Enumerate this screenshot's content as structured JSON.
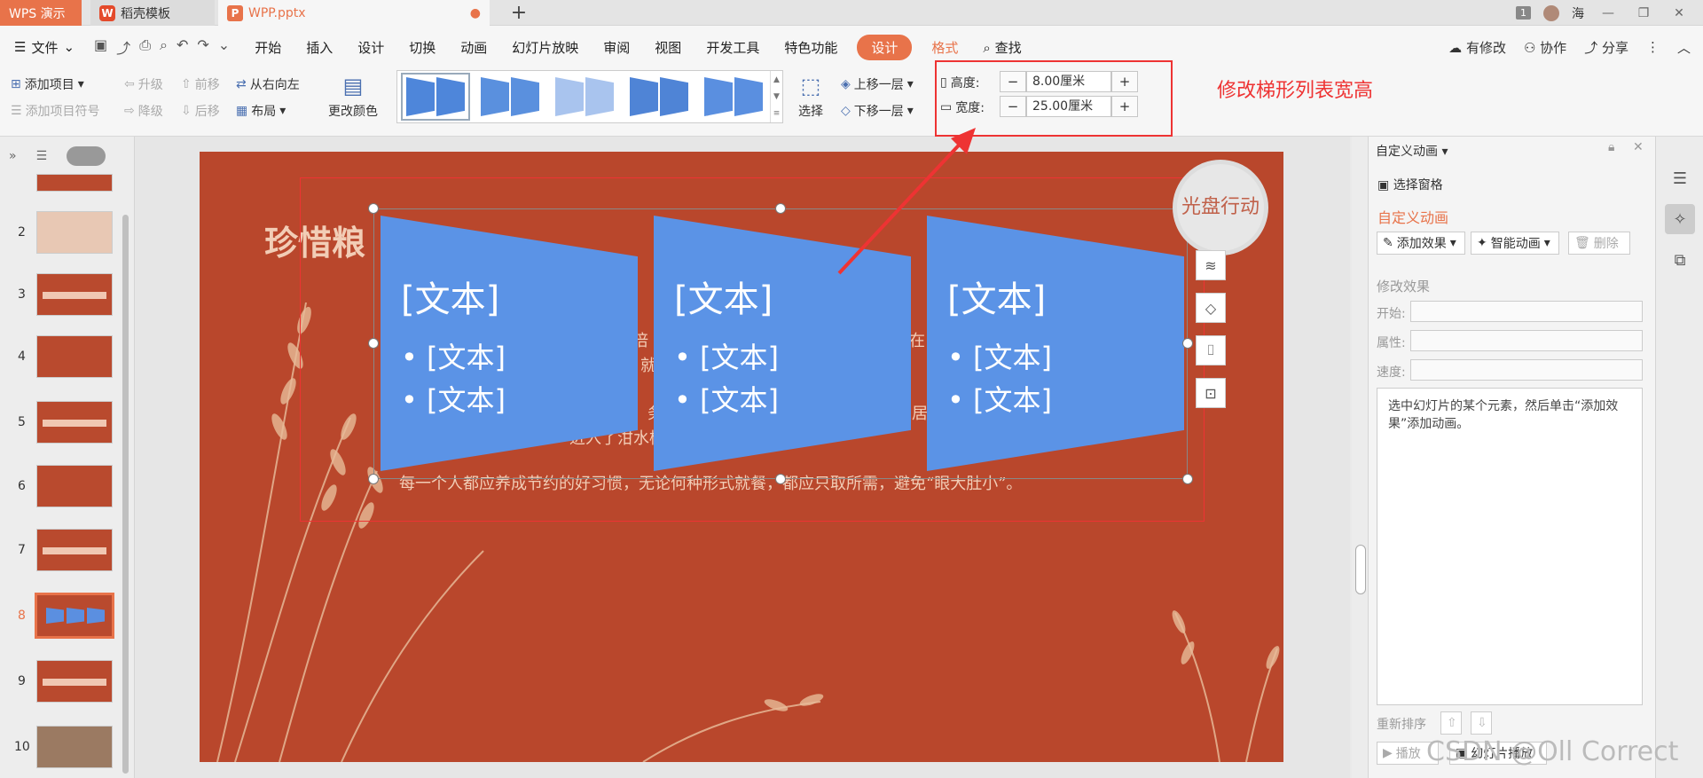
{
  "titlebar": {
    "wps_tab": "WPS 演示",
    "template_tab": "稻壳模板",
    "doc_tab": "WPP.pptx",
    "count_badge": "1",
    "user_name": "海"
  },
  "menu": {
    "file": "文件",
    "items": [
      "开始",
      "插入",
      "设计",
      "切换",
      "动画",
      "幻灯片放映",
      "审阅",
      "视图",
      "开发工具",
      "特色功能"
    ],
    "active": "设计",
    "format": "格式",
    "search": "查找",
    "right": [
      "有修改",
      "协作",
      "分享"
    ]
  },
  "ribbon": {
    "add_item": "添加项目",
    "promote": "升级",
    "forward": "前移",
    "right_to_left": "从右向左",
    "add_bullet": "添加项目符号",
    "demote": "降级",
    "backward": "后移",
    "layout": "布局",
    "change_color": "更改颜色",
    "select": "选择",
    "bring_forward": "上移一层",
    "send_backward": "下移一层",
    "height_label": "高度:",
    "height_value": "8.00厘米",
    "width_label": "宽度:",
    "width_value": "25.00厘米",
    "annotation": "修改梯形列表宽高"
  },
  "slides": {
    "numbers": [
      "2",
      "3",
      "4",
      "5",
      "6",
      "7",
      "8",
      "9",
      "10"
    ],
    "active": "8"
  },
  "slide": {
    "title": "珍惜粮",
    "frag1": "的倍",
    "frag2": "在",
    "frag3": "就",
    "frag4": "务",
    "frag5": "人居",
    "frag6": "进入了泔水桶",
    "body": "每一个人都应养成节约的好习惯，无论何种形式就餐，都应只取所需，避免“眼大肚小”。",
    "disc_text": "光盘行动",
    "shape_title": "[文本]",
    "shape_bullet": "• [文本]"
  },
  "anim_panel": {
    "title": "自定义动画",
    "select_pane": "选择窗格",
    "section": "自定义动画",
    "add_effect": "添加效果",
    "smart_anim": "智能动画",
    "delete": "删除",
    "modify": "修改效果",
    "start": "开始:",
    "property": "属性:",
    "speed": "速度:",
    "hint": "选中幻灯片的某个元素，然后单击“添加效果”添加动画。",
    "reorder": "重新排序",
    "play": "播放",
    "slideshow": "幻灯片播放"
  },
  "watermark": "CSDN @Oll Correct",
  "colors": {
    "accent": "#e8734a",
    "slide_bg": "#b9472c",
    "shape": "#5b93e6",
    "annotation": "#ee3333"
  }
}
